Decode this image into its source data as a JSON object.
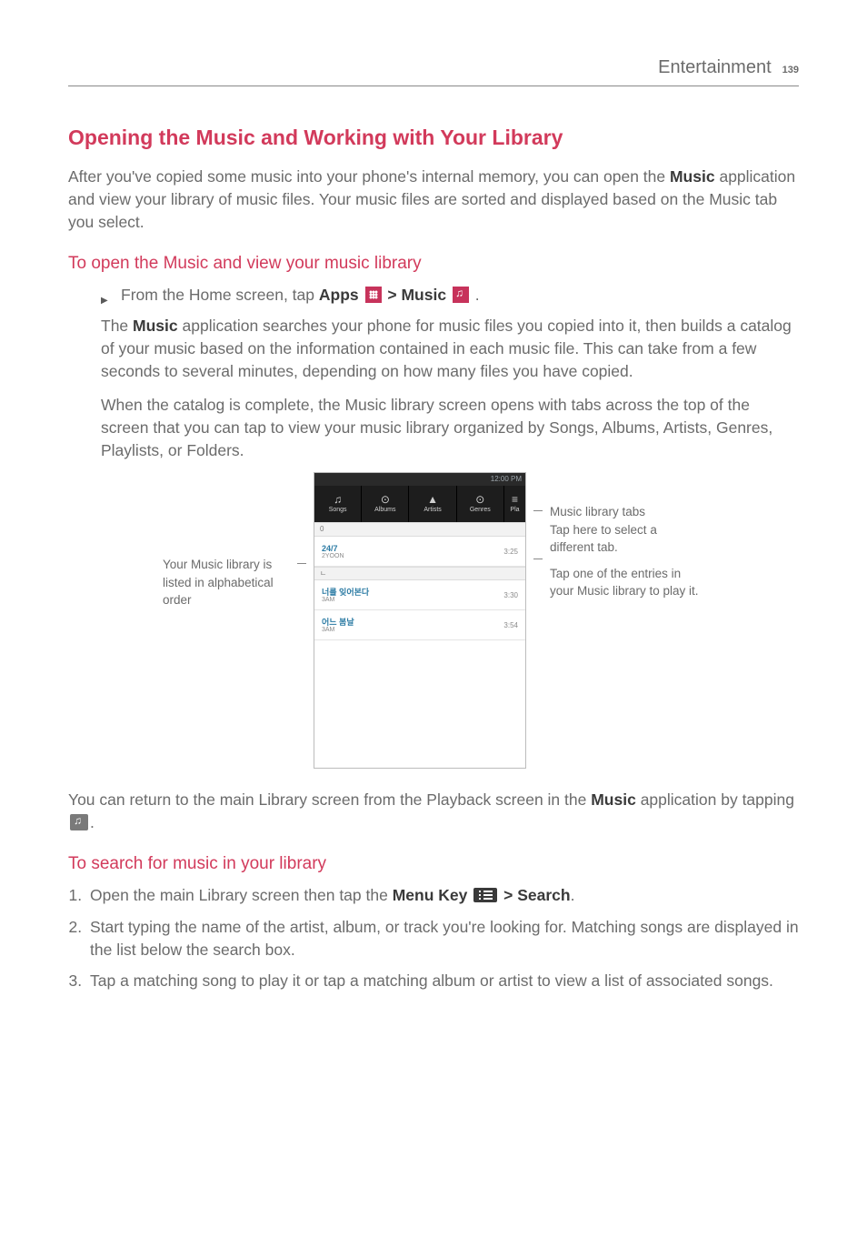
{
  "header": {
    "section": "Entertainment",
    "page": "139"
  },
  "h2": "Opening the Music and Working with Your Library",
  "intro_a": "After you've copied some music into your phone's internal memory, you can open the ",
  "intro_bold": "Music",
  "intro_b": " application and view your library of music files. Your music files are sorted and displayed based on the Music tab you select.",
  "sub1": "To open the Music and view your music library",
  "line1a": "From the Home screen, tap ",
  "apps_label": "Apps",
  "gt": " > ",
  "music_label": "Music",
  "period": " .",
  "para2a": "The ",
  "para2bold": "Music",
  "para2b": " application searches your phone for music files you copied into it, then builds a catalog of your music based on the information contained in each music file. This can take from a few seconds to several minutes, depending on how many files you have copied.",
  "para3": "When the catalog is complete, the Music library screen opens with tabs across the top of the screen that you can tap to view your music library organized by Songs, Albums, Artists, Genres, Playlists, or Folders.",
  "left_ann": "Your Music library is listed in alphabetical order",
  "right_ann1_t": "Music library tabs",
  "right_ann1_b": "Tap here to select a different tab.",
  "right_ann2": "Tap one of the entries in your Music library to play it.",
  "screenshot": {
    "status": "12:00 PM",
    "tabs": [
      "Songs",
      "Albums",
      "Artists",
      "Genres",
      "Pla"
    ],
    "tab_icons": [
      "♫",
      "⊙",
      "▲",
      "⊙",
      "≡"
    ],
    "sep1": "0",
    "t1_title": "24/7",
    "t1_artist": "2YOON",
    "t1_dur": "3:25",
    "sep2": "ㄴ",
    "t2_title": "너를 잊어본다",
    "t2_artist": "3AM",
    "t2_dur": "3:30",
    "t3_title": "어느 봄날",
    "t3_artist": "3AM",
    "t3_dur": "3:54"
  },
  "return_a": "You can return to the main Library screen from the Playback screen in the ",
  "return_bold": "Music",
  "return_b": " application by tapping ",
  "return_c": ".",
  "sub2": "To search for music in your library",
  "step1a": "Open the main Library screen then tap the ",
  "menu_label": "Menu Key",
  "search_label": "Search",
  "step2": "Start typing the name of the artist, album, or track you're looking for. Matching songs are displayed in the list below the search box.",
  "step3": "Tap a matching song to play it or tap a matching album or artist to view a list of associated songs."
}
